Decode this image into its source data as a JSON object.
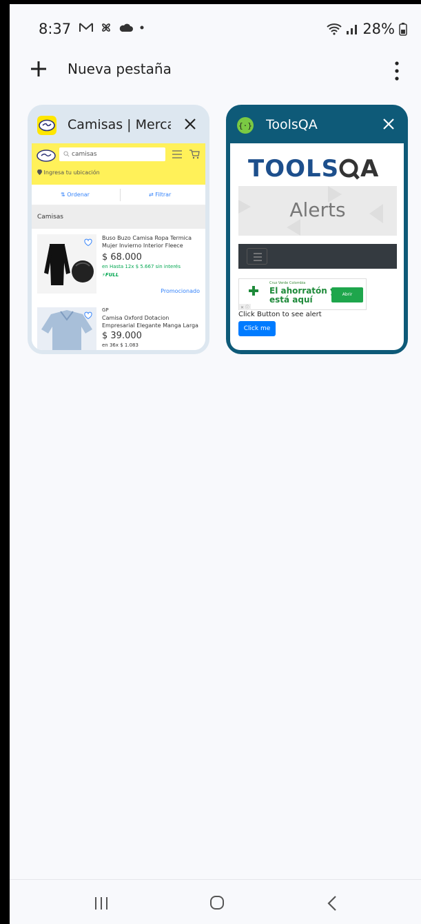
{
  "status_bar": {
    "time": "8:37",
    "battery": "28%"
  },
  "header": {
    "new_tab_label": "Nueva pestaña"
  },
  "tabs": [
    {
      "title": "Camisas | Merca",
      "page": {
        "search_text": "camisas",
        "location_text": "Ingresa tu ubicación",
        "sort_label": "Ordenar",
        "filter_label": "Filtrar",
        "section_title": "Camisas",
        "items": [
          {
            "name": "Buso Buzo Camisa Ropa Termica Mujer Invierno Interior Fleece",
            "price": "$ 68.000",
            "installments": "en Hasta 12x $ 5.667 sin interés",
            "badge": "FULL",
            "promo": "Promocionado"
          },
          {
            "seller": "GP",
            "name": "Camisa Oxford Dotacion Empresarial Elegante Manga Larga",
            "price": "$ 39.000",
            "installments": "en 36x $ 1.083"
          }
        ]
      }
    },
    {
      "title": "ToolsQA",
      "page": {
        "banner_text": "Alerts",
        "ad_brand": "Cruz Verde Colombia",
        "ad_headline_1": "El ahorratón ya",
        "ad_headline_2": "está aquí",
        "ad_button": "Abrir",
        "hint_text": "Click Button to see alert",
        "button_label": "Click me"
      }
    }
  ],
  "colors": {
    "merca_yellow": "#fff159",
    "toolsqa_tab": "#0e5a78",
    "merca_tab": "#dde7f0"
  }
}
